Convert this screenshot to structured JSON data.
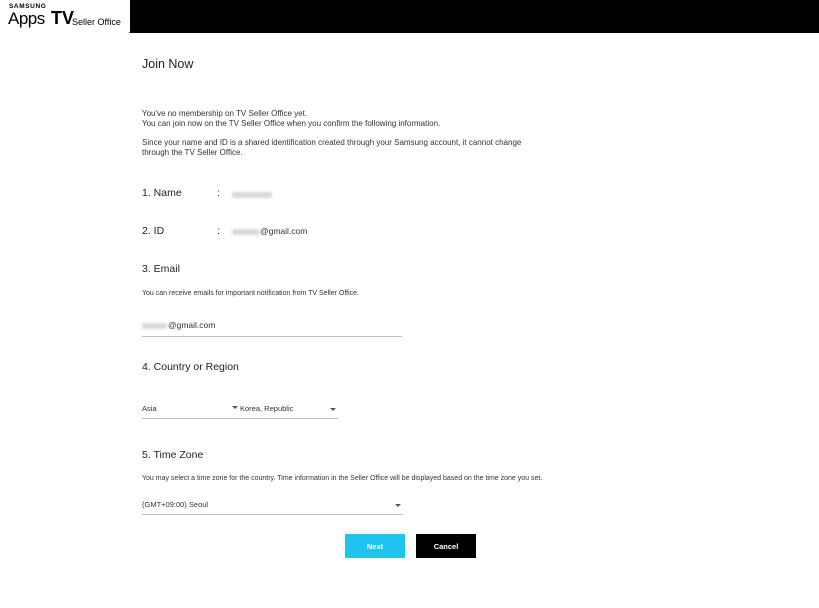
{
  "header": {
    "brand_top": "SAMSUNG",
    "brand_apps": "Apps",
    "brand_tv": "TV",
    "brand_sub": "Seller Office"
  },
  "page": {
    "title": "Join Now",
    "intro_1": "You've no membership on TV Seller Office yet.",
    "intro_2": "You can join now on the TV Seller Office when you confirm the following information.",
    "note_1": "Since your name and ID is a shared identification created through your Samsung account, it cannot change",
    "note_2": "through the TV Seller Office."
  },
  "name": {
    "label": "1. Name",
    "colon": ":"
  },
  "id": {
    "label": "2. ID",
    "colon": ":",
    "domain": "@gmail.com"
  },
  "email": {
    "label": "3. Email",
    "desc": "You can receive emails for important notification from TV Seller Office.",
    "domain": "@gmail.com"
  },
  "country": {
    "label": "4. Country or Region",
    "region_value": "Asia",
    "country_value": "Korea, Republic"
  },
  "timezone": {
    "label": "5. Time Zone",
    "desc": "You may select a time zone for the country. Time information in the Seller Office will be displayed based on the time zone you set.",
    "value": "(GMT+09:00) Seoul"
  },
  "buttons": {
    "next": "Next",
    "cancel": "Cancel"
  },
  "colors": {
    "accent": "#1ec3ee",
    "topbar": "#000000"
  }
}
